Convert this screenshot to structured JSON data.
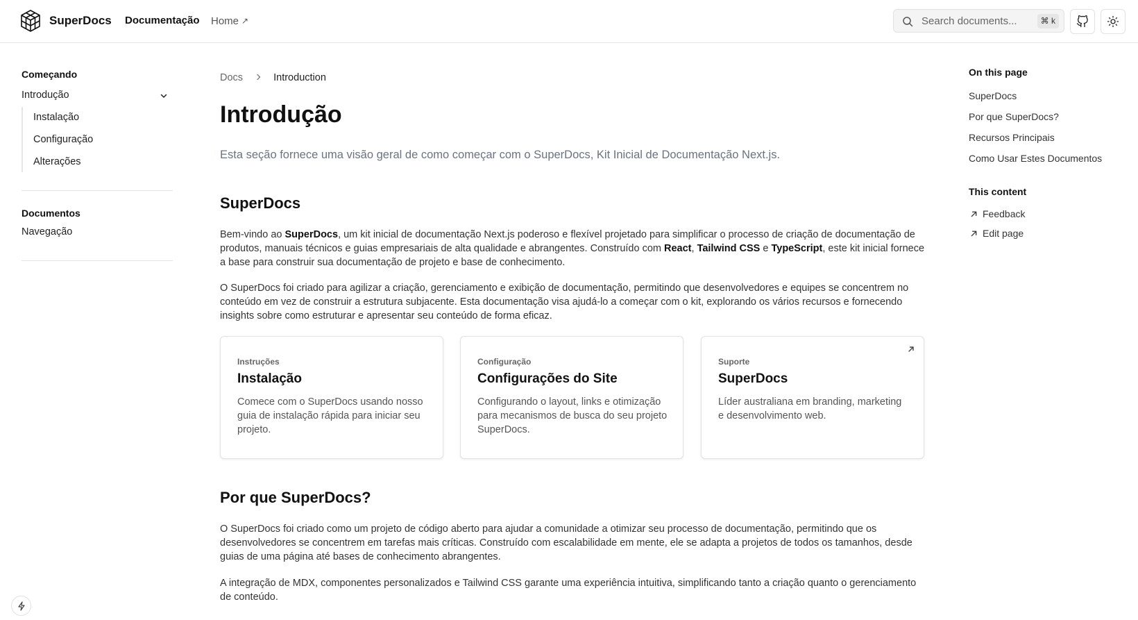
{
  "header": {
    "brand": "SuperDocs",
    "nav_docs": "Documentação",
    "nav_home": "Home",
    "search_placeholder": "Search documents...",
    "search_shortcut": "⌘ k"
  },
  "sidebar": {
    "group1": "Começando",
    "parent": "Introdução",
    "children": [
      "Instalação",
      "Configuração",
      "Alterações"
    ],
    "group2": "Documentos",
    "group2_items": [
      "Navegação"
    ]
  },
  "breadcrumb": {
    "root": "Docs",
    "current": "Introduction"
  },
  "main": {
    "title": "Introdução",
    "lead": "Esta seção fornece uma visão geral de como começar com o SuperDocs, Kit Inicial de Documentação Next.js.",
    "section1_title": "SuperDocs",
    "p1": {
      "a": "Bem-vindo ao ",
      "b": "SuperDocs",
      "c": ", um kit inicial de documentação Next.js poderoso e flexível projetado para simplificar o processo de criação de documentação de produtos, manuais técnicos e guias empresariais de alta qualidade e abrangentes. Construído com ",
      "d": "React",
      "e": ", ",
      "f": "Tailwind CSS",
      "g": " e ",
      "h": "TypeScript",
      "i": ", este kit inicial fornece a base para construir sua documentação de projeto e base de conhecimento."
    },
    "p2": "O SuperDocs foi criado para agilizar a criação, gerenciamento e exibição de documentação, permitindo que desenvolvedores e equipes se concentrem no conteúdo em vez de construir a estrutura subjacente. Esta documentação visa ajudá-lo a começar com o kit, explorando os vários recursos e fornecendo insights sobre como estruturar e apresentar seu conteúdo de forma eficaz.",
    "cards": [
      {
        "tag": "Instruções",
        "title": "Instalação",
        "desc": "Comece com o SuperDocs usando nosso guia de instalação rápida para iniciar seu projeto."
      },
      {
        "tag": "Configuração",
        "title": "Configurações do Site",
        "desc": "Configurando o layout, links e otimização para mecanismos de busca do seu projeto SuperDocs."
      },
      {
        "tag": "Suporte",
        "title": "SuperDocs",
        "desc": "Líder australiana em branding, marketing e desenvolvimento web."
      }
    ],
    "section2_title": "Por que SuperDocs?",
    "p3": "O SuperDocs foi criado como um projeto de código aberto para ajudar a comunidade a otimizar seu processo de documentação, permitindo que os desenvolvedores se concentrem em tarefas mais críticas. Construído com escalabilidade em mente, ele se adapta a projetos de todos os tamanhos, desde guias de uma página até bases de conhecimento abrangentes.",
    "p4": "A integração de MDX, componentes personalizados e Tailwind CSS garante uma experiência intuitiva, simplificando tanto a criação quanto o gerenciamento de conteúdo."
  },
  "toc": {
    "title": "On this page",
    "items": [
      "SuperDocs",
      "Por que SuperDocs?",
      "Recursos Principais",
      "Como Usar Estes Documentos"
    ],
    "content_title": "This content",
    "feedback": "Feedback",
    "edit": "Edit page"
  },
  "icons": {
    "logo": "cube-logo-icon",
    "search": "search-icon",
    "github": "github-icon",
    "theme": "sun-icon",
    "bolt": "bolt-icon"
  }
}
